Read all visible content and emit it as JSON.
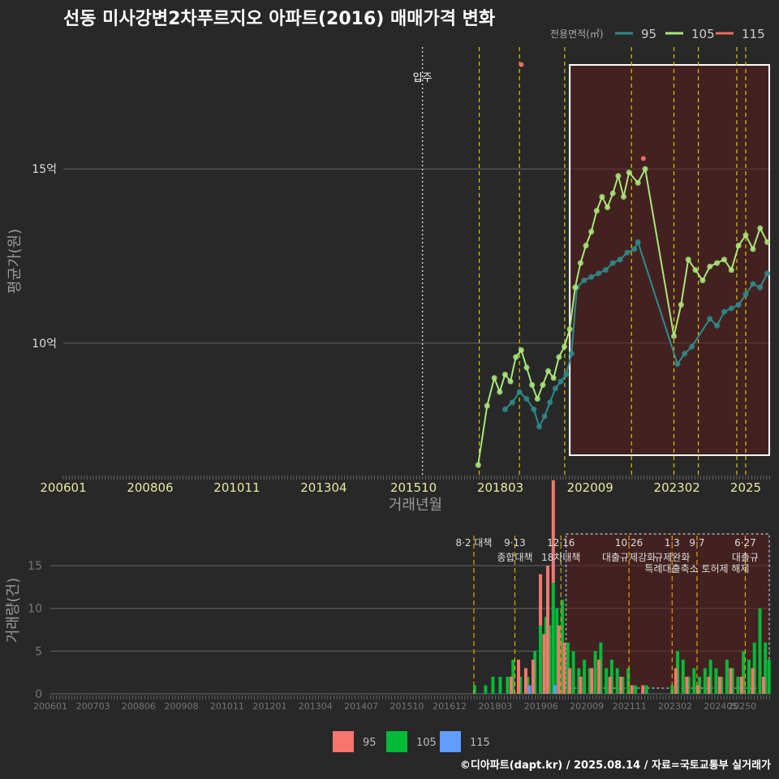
{
  "title": "선동 미사강변2차푸르지오 아파트(2016) 매매가격 변화",
  "legend_top": {
    "title": "전용면적(㎡)",
    "items": [
      {
        "label": "95",
        "color": "#2E8B8B"
      },
      {
        "label": "105",
        "color": "#A8E878"
      },
      {
        "label": "115",
        "color": "#F26B5B"
      }
    ]
  },
  "legend_bottom": {
    "items": [
      {
        "label": "95",
        "color": "#F8766D"
      },
      {
        "label": "105",
        "color": "#00BA38"
      },
      {
        "label": "115",
        "color": "#619CFF"
      }
    ]
  },
  "footer": "©디아파트(dapt.kr) / 2025.08.14 / 자료=국토교통부 실거래가",
  "chart_data": [
    {
      "type": "line",
      "title": "선동 미사강변2차푸르지오 아파트(2016) 매매가격 변화",
      "xlabel": "거래년월",
      "ylabel": "평균가(원)",
      "x_ticks": [
        "200601",
        "200806",
        "201011",
        "201304",
        "201510",
        "201803",
        "202009",
        "202302",
        "2025"
      ],
      "y_ticks": [
        {
          "value": 10,
          "label": "10억"
        },
        {
          "value": 15,
          "label": "15억"
        }
      ],
      "ylim": [
        6.2,
        18.5
      ],
      "xlim": [
        2006.0,
        2025.7
      ],
      "grid": true,
      "legend_position": "top-right",
      "annotations": [
        {
          "x": 2016.0,
          "label": "입주"
        }
      ],
      "policy_lines": [
        2017.58,
        2018.7,
        2019.96,
        2021.82,
        2023.0,
        2023.68,
        2024.75,
        2025.0
      ],
      "highlight_range": [
        2020.1,
        2025.7
      ],
      "series": [
        {
          "name": "95",
          "values": [
            [
              2018.3,
              8.1
            ],
            [
              2018.5,
              8.3
            ],
            [
              2018.7,
              8.6
            ],
            [
              2018.9,
              8.4
            ],
            [
              2019.1,
              8.1
            ],
            [
              2019.25,
              7.6
            ],
            [
              2019.4,
              7.9
            ],
            [
              2019.55,
              8.3
            ],
            [
              2019.7,
              8.7
            ],
            [
              2019.85,
              8.9
            ],
            [
              2020.0,
              9.1
            ],
            [
              2020.15,
              9.7
            ],
            [
              2020.3,
              11.6
            ],
            [
              2020.5,
              11.8
            ],
            [
              2020.7,
              11.9
            ],
            [
              2020.9,
              12.0
            ],
            [
              2021.1,
              12.1
            ],
            [
              2021.3,
              12.3
            ],
            [
              2021.5,
              12.4
            ],
            [
              2021.7,
              12.6
            ],
            [
              2021.9,
              12.7
            ],
            [
              2022.0,
              12.9
            ],
            [
              2023.1,
              9.4
            ],
            [
              2023.3,
              9.7
            ],
            [
              2023.5,
              9.9
            ],
            [
              2024.0,
              10.7
            ],
            [
              2024.2,
              10.5
            ],
            [
              2024.4,
              10.9
            ],
            [
              2024.6,
              11.0
            ],
            [
              2024.8,
              11.1
            ],
            [
              2025.0,
              11.4
            ],
            [
              2025.2,
              11.7
            ],
            [
              2025.4,
              11.6
            ],
            [
              2025.6,
              12.0
            ]
          ]
        },
        {
          "name": "105",
          "values": [
            [
              2017.55,
              6.5
            ],
            [
              2017.8,
              8.2
            ],
            [
              2018.0,
              9.0
            ],
            [
              2018.15,
              8.6
            ],
            [
              2018.3,
              9.1
            ],
            [
              2018.45,
              8.9
            ],
            [
              2018.6,
              9.6
            ],
            [
              2018.75,
              9.8
            ],
            [
              2018.9,
              9.3
            ],
            [
              2019.05,
              8.8
            ],
            [
              2019.2,
              8.4
            ],
            [
              2019.35,
              8.8
            ],
            [
              2019.5,
              9.2
            ],
            [
              2019.65,
              9.0
            ],
            [
              2019.8,
              9.6
            ],
            [
              2019.95,
              9.9
            ],
            [
              2020.1,
              10.4
            ],
            [
              2020.25,
              11.6
            ],
            [
              2020.4,
              12.3
            ],
            [
              2020.55,
              12.8
            ],
            [
              2020.7,
              13.2
            ],
            [
              2020.85,
              13.8
            ],
            [
              2021.0,
              14.2
            ],
            [
              2021.15,
              13.9
            ],
            [
              2021.3,
              14.3
            ],
            [
              2021.45,
              14.8
            ],
            [
              2021.6,
              14.2
            ],
            [
              2021.75,
              14.9
            ],
            [
              2022.0,
              14.6
            ],
            [
              2022.2,
              15.0
            ],
            [
              2023.0,
              10.2
            ],
            [
              2023.2,
              11.1
            ],
            [
              2023.4,
              12.4
            ],
            [
              2023.6,
              12.1
            ],
            [
              2023.8,
              11.8
            ],
            [
              2024.0,
              12.2
            ],
            [
              2024.2,
              12.3
            ],
            [
              2024.4,
              12.4
            ],
            [
              2024.6,
              12.1
            ],
            [
              2024.8,
              12.8
            ],
            [
              2025.0,
              13.1
            ],
            [
              2025.2,
              12.7
            ],
            [
              2025.4,
              13.3
            ],
            [
              2025.6,
              12.9
            ]
          ]
        },
        {
          "name": "115",
          "values": [
            [
              2018.75,
              18.0
            ],
            [
              2022.15,
              15.3
            ]
          ]
        }
      ]
    },
    {
      "type": "bar",
      "ylabel": "거래량(건)",
      "x_ticks": [
        "200601",
        "200703",
        "200806",
        "200908",
        "201011",
        "201201",
        "201304",
        "201407",
        "201510",
        "201612",
        "201803",
        "201906",
        "202009",
        "202111",
        "202302",
        "202405",
        "20250"
      ],
      "y_ticks": [
        0,
        5,
        10,
        15
      ],
      "ylim": [
        0,
        19
      ],
      "xlim": [
        2006.0,
        2025.7
      ],
      "grid": true,
      "stacked": true,
      "highlight_range": [
        2020.1,
        2025.7
      ],
      "policy_lines": [
        {
          "x": 2017.58,
          "label": "8·2 대책",
          "label2": ""
        },
        {
          "x": 2018.7,
          "label": "9·13",
          "label2": "종합대책"
        },
        {
          "x": 2019.96,
          "label": "12·16",
          "label2": "18차대책"
        },
        {
          "x": 2021.82,
          "label": "10·26",
          "label2": "대출규제강화"
        },
        {
          "x": 2023.0,
          "label": "1·3",
          "label2": "규제완화"
        },
        {
          "x": 2023.68,
          "label": "9·7",
          "label2": "특례대출축소 토허제 해제"
        },
        {
          "x": 2025.0,
          "label": "6·27",
          "label2": "대출규"
        }
      ],
      "series": [
        {
          "name": "95",
          "color": "#F8766D",
          "values": [
            [
              2018.6,
              2
            ],
            [
              2018.8,
              4
            ],
            [
              2019.0,
              3
            ],
            [
              2019.2,
              4
            ],
            [
              2019.4,
              6
            ],
            [
              2019.5,
              7
            ],
            [
              2019.6,
              15
            ],
            [
              2019.75,
              12
            ],
            [
              2019.9,
              8
            ],
            [
              2020.05,
              6
            ],
            [
              2020.2,
              3
            ],
            [
              2020.5,
              2
            ],
            [
              2020.8,
              3
            ],
            [
              2021.0,
              4
            ],
            [
              2021.3,
              2
            ],
            [
              2021.6,
              2
            ],
            [
              2021.9,
              1
            ],
            [
              2022.2,
              1
            ],
            [
              2023.1,
              3
            ],
            [
              2023.4,
              2
            ],
            [
              2023.7,
              1
            ],
            [
              2024.0,
              2
            ],
            [
              2024.3,
              2
            ],
            [
              2024.6,
              3
            ],
            [
              2024.9,
              2
            ],
            [
              2025.2,
              3
            ],
            [
              2025.5,
              2
            ]
          ]
        },
        {
          "name": "105",
          "values": [
            [
              2017.6,
              1
            ],
            [
              2017.9,
              1
            ],
            [
              2018.1,
              2
            ],
            [
              2018.3,
              2
            ],
            [
              2018.5,
              2
            ],
            [
              2018.65,
              4
            ],
            [
              2018.85,
              2
            ],
            [
              2019.05,
              2
            ],
            [
              2019.25,
              5
            ],
            [
              2019.4,
              8
            ],
            [
              2019.55,
              9
            ],
            [
              2019.65,
              8
            ],
            [
              2019.75,
              13
            ],
            [
              2019.85,
              10
            ],
            [
              2020.0,
              11
            ],
            [
              2020.15,
              6
            ],
            [
              2020.3,
              5
            ],
            [
              2020.45,
              3
            ],
            [
              2020.6,
              4
            ],
            [
              2020.75,
              3
            ],
            [
              2020.9,
              5
            ],
            [
              2021.05,
              6
            ],
            [
              2021.2,
              3
            ],
            [
              2021.35,
              4
            ],
            [
              2021.5,
              3
            ],
            [
              2021.65,
              2
            ],
            [
              2021.8,
              3
            ],
            [
              2022.0,
              1
            ],
            [
              2022.3,
              1
            ],
            [
              2023.0,
              1
            ],
            [
              2023.15,
              5
            ],
            [
              2023.3,
              4
            ],
            [
              2023.45,
              2
            ],
            [
              2023.6,
              3
            ],
            [
              2023.75,
              2
            ],
            [
              2023.9,
              3
            ],
            [
              2024.05,
              4
            ],
            [
              2024.2,
              3
            ],
            [
              2024.35,
              2
            ],
            [
              2024.5,
              4
            ],
            [
              2024.65,
              3
            ],
            [
              2024.8,
              2
            ],
            [
              2024.95,
              5
            ],
            [
              2025.1,
              4
            ],
            [
              2025.25,
              6
            ],
            [
              2025.4,
              10
            ],
            [
              2025.55,
              6
            ],
            [
              2025.65,
              4
            ]
          ]
        },
        {
          "name": "115",
          "values": [
            [
              2019.1,
              1
            ],
            [
              2019.8,
              1
            ]
          ]
        }
      ]
    }
  ]
}
